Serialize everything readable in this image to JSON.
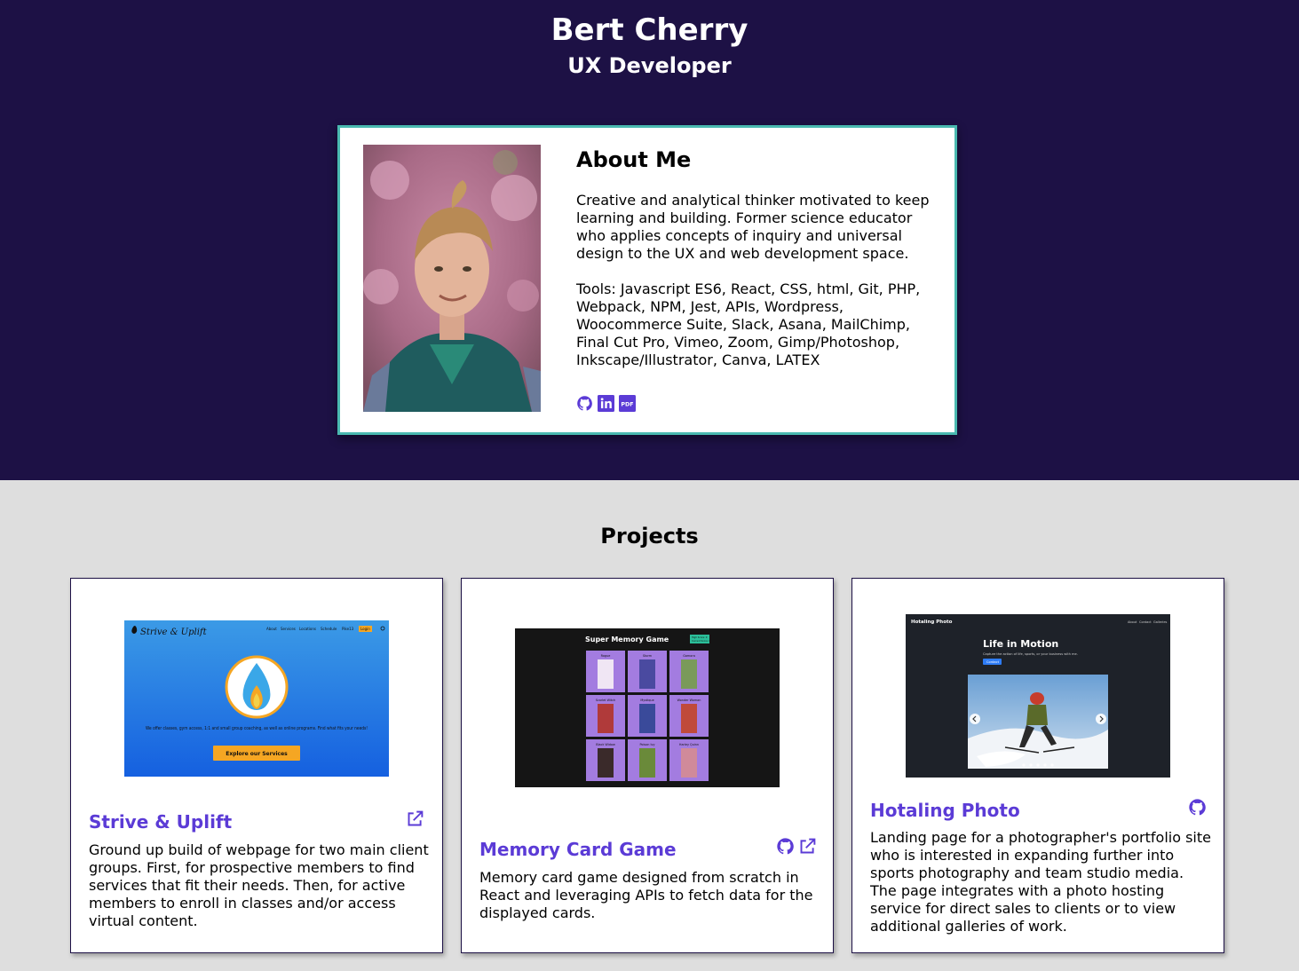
{
  "header": {
    "name": "Bert Cherry",
    "title": "UX Developer"
  },
  "about": {
    "heading": "About Me",
    "bio": "Creative and analytical thinker motivated to keep learning and building. Former science educator who applies concepts of inquiry and universal design to the UX and web development space.",
    "tools": "Tools: Javascript ES6, React, CSS, html, Git, PHP, Webpack, NPM, Jest, APIs, Wordpress, Woocommerce Suite, Slack, Asana, MailChimp, Final Cut Pro, Vimeo, Zoom, Gimp/Photoshop, Inkscape/Illustrator, Canva, LATEX",
    "links": [
      "github-icon",
      "linkedin-icon",
      "pdf-icon"
    ],
    "pdf_label": "PDF"
  },
  "projects": {
    "heading": "Projects",
    "items": [
      {
        "title": "Strive & Uplift",
        "description": "Ground up build of webpage for two main client groups. First, for prospective members to find services that fit their needs. Then, for active members to enroll in classes and/or access virtual content.",
        "icons": [
          "external-link-icon"
        ],
        "screenshot": {
          "logo": "Strive & Uplift",
          "nav": [
            "About",
            "Services",
            "Locations",
            "Schedule",
            "Pike13",
            "Login"
          ],
          "tagline": "We offer classes, gym access, 1:1 and small group coaching, as well as online programs. Find what fits your needs!",
          "cta": "Explore our Services"
        }
      },
      {
        "title": "Memory Card Game",
        "description": "Memory card game designed from scratch in React and leveraging APIs to fetch data for the displayed cards.",
        "icons": [
          "github-icon",
          "external-link-icon"
        ],
        "screenshot": {
          "title": "Super Memory Game",
          "score": [
            "High Score: 0",
            "Current Score: 0"
          ],
          "cards": [
            "Rogue",
            "Storm",
            "Gamora",
            "Scarlet Witch",
            "Mystique",
            "Wonder Woman",
            "Black Widow",
            "Poison Ivy",
            "Harley Quinn"
          ]
        }
      },
      {
        "title": "Hotaling Photo",
        "description": "Landing page for a photographer's portfolio site who is interested in expanding further into sports photography and team studio media. The page integrates with a photo hosting service for direct sales to clients or to view additional galleries of work.",
        "icons": [
          "github-icon"
        ],
        "screenshot": {
          "brand": "Hotaling Photo",
          "nav": [
            "About",
            "Contact",
            "Galleries"
          ],
          "headline": "Life in Motion",
          "subline": "Capture the action of life, sports, or your business with me.",
          "button": "Contact"
        }
      }
    ]
  },
  "colors": {
    "hero_bg": "#1d1145",
    "accent_border": "#4ab9b0",
    "link_purple": "#5b3bd6",
    "section_bg": "#dedede"
  }
}
